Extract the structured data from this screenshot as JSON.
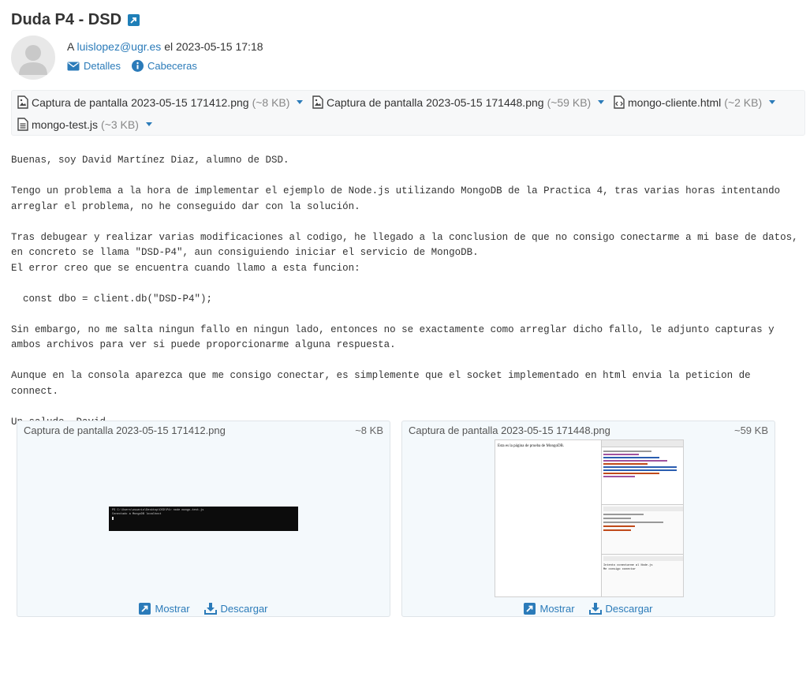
{
  "message": {
    "subject": "Duda P4 - DSD",
    "to_prefix": "A",
    "to_email": "luislopez@ugr.es",
    "date_prefix": "el",
    "date": "2023-05-15 17:18",
    "details_label": "Detalles",
    "headers_label": "Cabeceras"
  },
  "attachments": [
    {
      "name": "Captura de pantalla 2023-05-15 171412.png",
      "size": "(~8 KB)",
      "icon": "image-file-icon"
    },
    {
      "name": "Captura de pantalla 2023-05-15 171448.png",
      "size": "(~59 KB)",
      "icon": "image-file-icon"
    },
    {
      "name": "mongo-cliente.html",
      "size": "(~2 KB)",
      "icon": "code-file-icon"
    },
    {
      "name": "mongo-test.js",
      "size": "(~3 KB)",
      "icon": "text-file-icon"
    }
  ],
  "body": "Buenas, soy David Martínez Diaz, alumno de DSD.\n\nTengo un problema a la hora de implementar el ejemplo de Node.js utilizando MongoDB de la Practica 4, tras varias horas intentando arreglar el problema, no he conseguido dar con la solución.\n\nTras debugear y realizar varias modificaciones al codigo, he llegado a la conclusion de que no consigo conectarme a mi base de datos, en concreto se llama \"DSD-P4\", aun consiguiendo iniciar el servicio de MongoDB.\nEl error creo que se encuentra cuando llamo a esta funcion:\n\n  const dbo = client.db(\"DSD-P4\");\n\nSin embargo, no me salta ningun fallo en ningun lado, entonces no se exactamente como arreglar dicho fallo, le adjunto capturas y ambos archivos para ver si puede proporcionarme alguna respuesta.\n\nAunque en la consola aparezca que me consigo conectar, es simplemente que el socket implementado en html envia la peticion de connect.\n\nUn saludo, David.",
  "previews": [
    {
      "name": "Captura de pantalla 2023-05-15 171412.png",
      "size": "~8 KB",
      "show_label": "Mostrar",
      "download_label": "Descargar",
      "terminal_lines": [
        "PS C:\\Users\\usuario\\Desktop\\DSD\\P4> node mongo-test.js",
        "Conectado a MongoDB localhost"
      ]
    },
    {
      "name": "Captura de pantalla 2023-05-15 171448.png",
      "size": "~59 KB",
      "show_label": "Mostrar",
      "download_label": "Descargar",
      "page_text": "Esta es la página de prueba de MongoDB.",
      "console_lines": [
        "Intento conectarme al Node.js",
        "Me consigo conectar"
      ]
    }
  ],
  "colors": {
    "link": "#2b7bb9",
    "icon": "#1f7fb8"
  }
}
